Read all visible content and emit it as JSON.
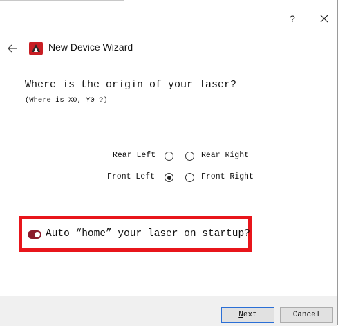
{
  "window": {
    "help_label": "?",
    "close_icon": "close-icon"
  },
  "header": {
    "back_icon": "back-arrow-icon",
    "app_icon": "lightburn-logo-icon",
    "title": "New Device Wizard"
  },
  "main": {
    "question": "Where is the origin of your laser?",
    "subquestion": "(Where is X0, Y0 ?)",
    "origin_options": [
      {
        "label": "Rear Left",
        "checked": false
      },
      {
        "label": "Rear Right",
        "checked": false
      },
      {
        "label": "Front Left",
        "checked": true
      },
      {
        "label": "Front Right",
        "checked": false
      }
    ],
    "home_toggle": {
      "label": "Auto “home” your laser on startup?",
      "on": true,
      "highlight_color": "#e8151b",
      "toggle_color": "#8a1a2a"
    }
  },
  "footer": {
    "next_mnemonic": "N",
    "next_rest": "ext",
    "cancel_label": "Cancel"
  }
}
